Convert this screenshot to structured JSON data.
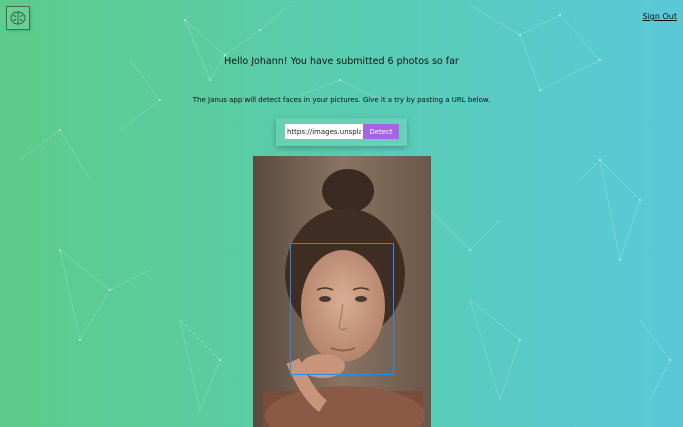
{
  "header": {
    "logo_icon": "brain-icon",
    "signout_label": "Sign Out"
  },
  "main": {
    "greeting": "Hello Johann! You have submitted 6 photos so far",
    "instruction": "The Janus app will detect faces in your pictures. Give it a try by pasting a URL below.",
    "url_value": "https://images.unspla",
    "detect_label": "Detect"
  },
  "colors": {
    "gradient_start": "#5ecb8a",
    "gradient_end": "#59c9da",
    "button": "#a862e4",
    "face_box": "#1f8ff2"
  }
}
